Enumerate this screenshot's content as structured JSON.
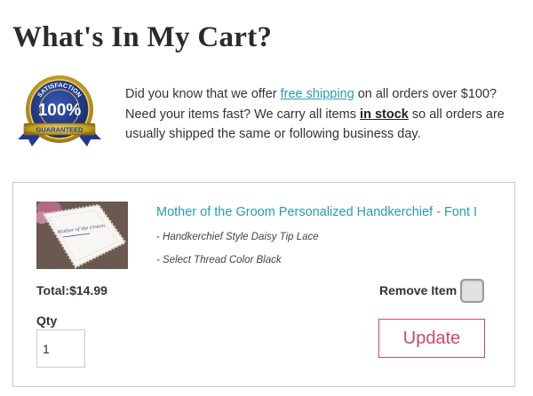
{
  "page": {
    "title": "What's In My Cart?"
  },
  "seal": {
    "top_text": "SATISFACTION",
    "percent": "100%",
    "bottom_text": "GUARANTEED"
  },
  "promo": {
    "line1_pre": "Did you know that we offer ",
    "free_shipping_link": "free shipping",
    "line1_post": " on all orders over $100?",
    "line2_pre": "Need your items fast? We carry all items ",
    "in_stock_link": "in stock",
    "line2_post": " so all orders are",
    "line3": "usually shipped the same or following business day."
  },
  "cart": {
    "item": {
      "name": "Mother of the Groom Personalized Handkerchief - Font I",
      "options": [
        "- Handkerchief Style Daisy Tip Lace",
        "- Select Thread Color Black"
      ],
      "thumbnail_text": "Mother of the Groom"
    },
    "total_label": "Total:",
    "total_value": "$14.99",
    "remove_label": "Remove Item",
    "remove_checked": false,
    "qty_label": "Qty",
    "qty_value": "1",
    "update_label": "Update"
  },
  "colors": {
    "link": "#2a9bb0",
    "button_accent": "#d2456a",
    "seal_blue": "#1e3a8c",
    "seal_gold": "#c9a227"
  }
}
